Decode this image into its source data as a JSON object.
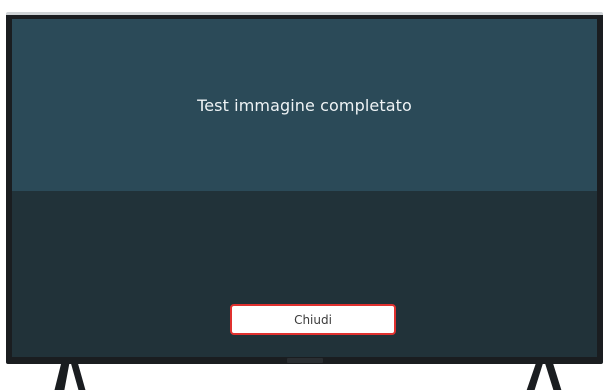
{
  "dialog": {
    "message": "Test immagine completato",
    "close_label": "Chiudi"
  },
  "colors": {
    "upper_panel": "#2b4a58",
    "lower_panel": "#213239",
    "button_focus_border": "#e0312f",
    "button_background": "#ffffff",
    "bezel": "#1a1d20"
  }
}
